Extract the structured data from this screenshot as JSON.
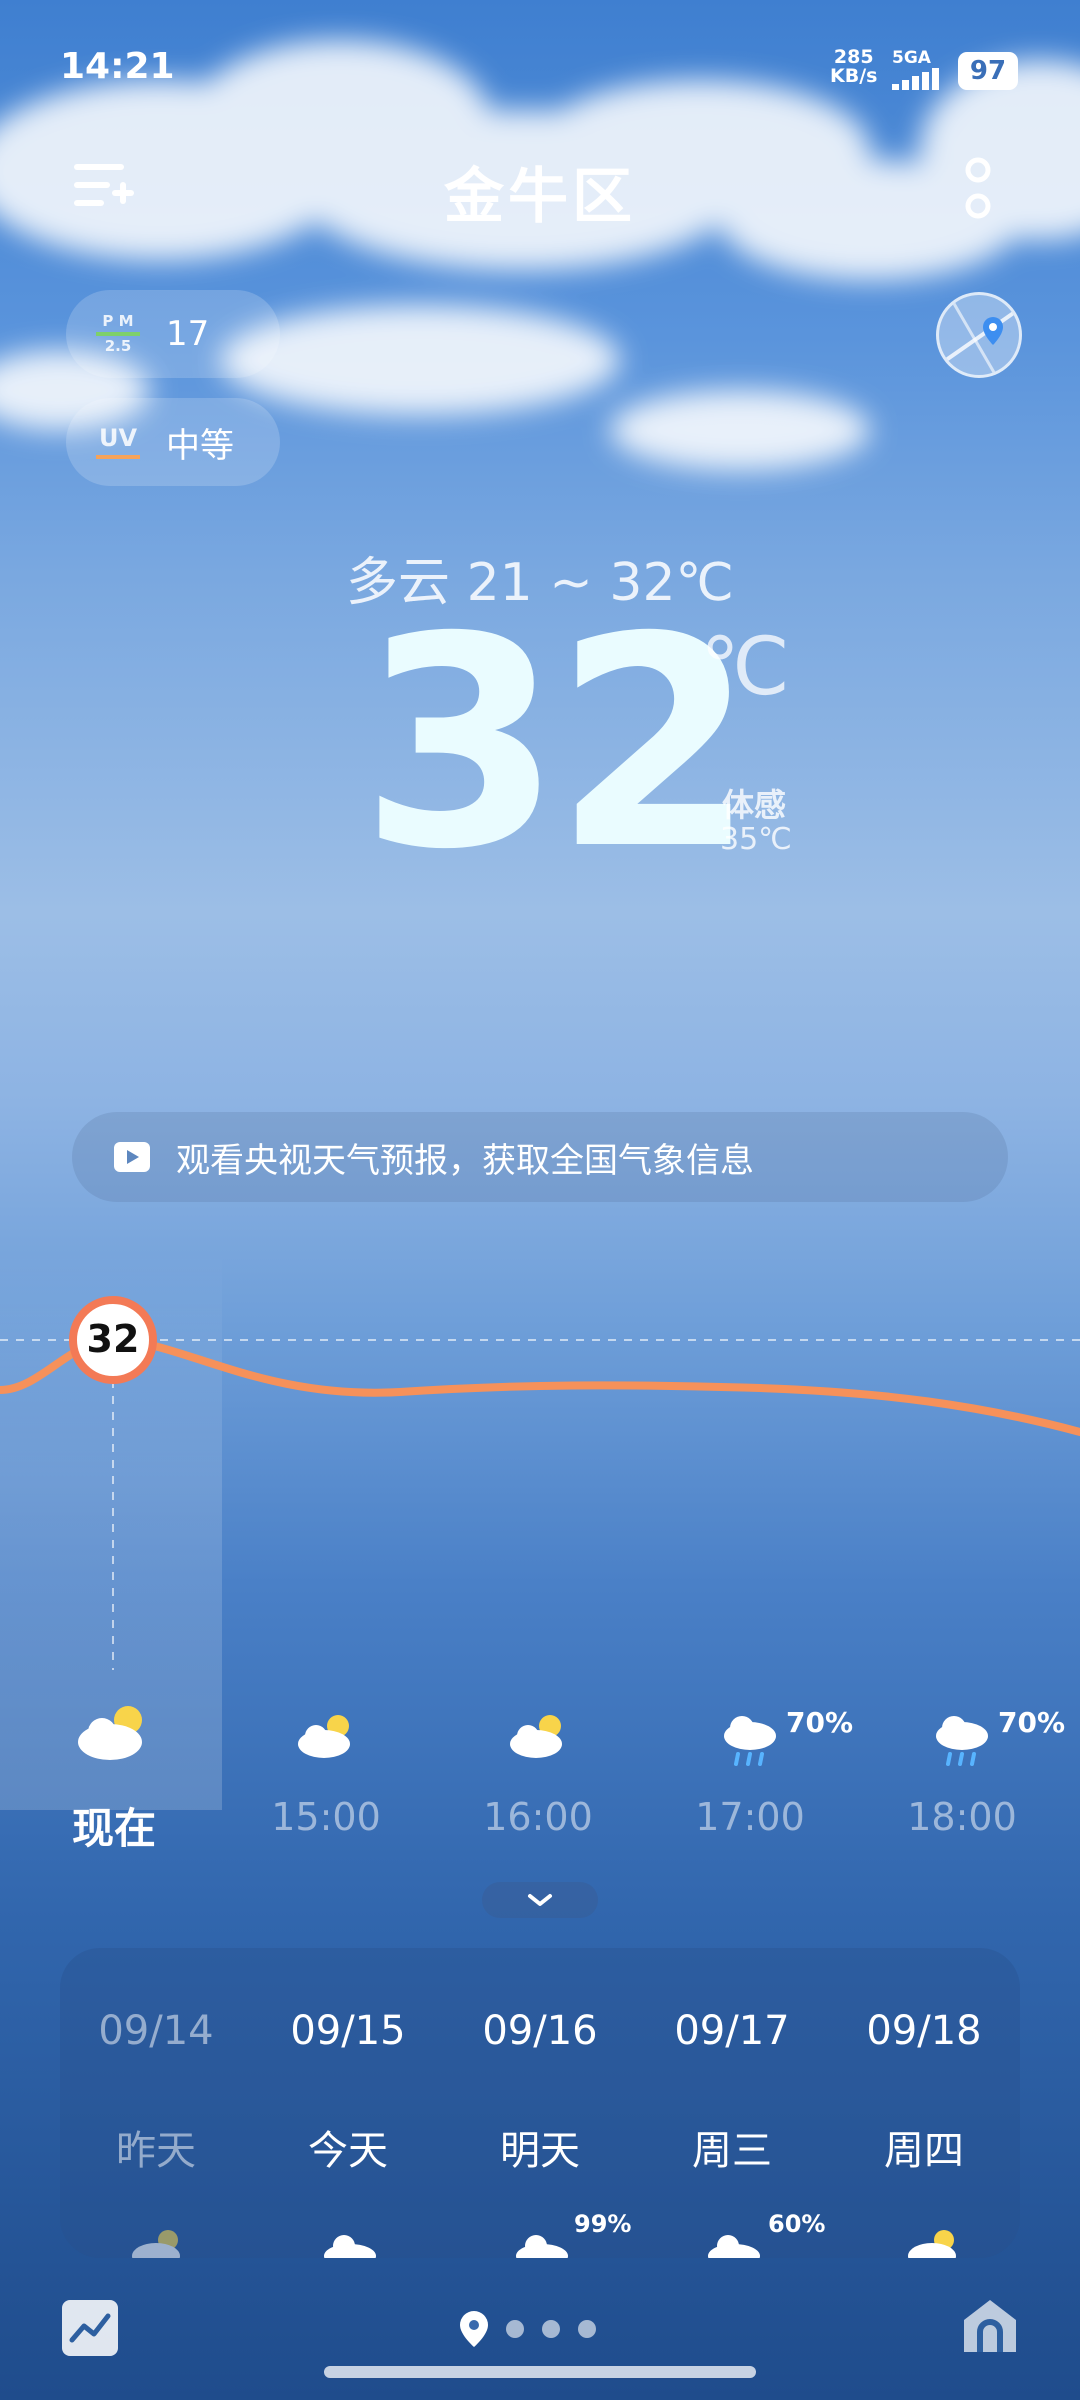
{
  "status_bar": {
    "time": "14:21",
    "net_speed_value": "285",
    "net_speed_unit": "KB/s",
    "network_type": "5GA",
    "battery": "97"
  },
  "header": {
    "city": "金牛区",
    "menu_icon": "list-add-icon",
    "more_icon": "vertical-dots-icon"
  },
  "air": {
    "pm_label_top": "P M",
    "pm_label_bottom": "2.5",
    "pm_value": "17",
    "uv_label": "UV",
    "uv_value": "中等"
  },
  "current": {
    "condition_range": "多云  21 ~ 32℃",
    "temp": "32",
    "unit": "℃",
    "feels_label": "体感",
    "feels_value": "35℃"
  },
  "banner": {
    "text": "观看央视天气预报，获取全国气象信息",
    "icon": "video-play-icon"
  },
  "hourly": {
    "current_marker": "32",
    "items": [
      {
        "time": "现在",
        "icon": "partly-cloudy-icon",
        "precip": ""
      },
      {
        "time": "15:00",
        "icon": "partly-cloudy-icon",
        "precip": ""
      },
      {
        "time": "16:00",
        "icon": "partly-cloudy-icon",
        "precip": ""
      },
      {
        "time": "17:00",
        "icon": "rain-cloud-icon",
        "precip": "70%"
      },
      {
        "time": "18:00",
        "icon": "rain-cloud-icon",
        "precip": "70%"
      }
    ]
  },
  "daily": {
    "items": [
      {
        "date": "09/14",
        "day": "昨天",
        "precip": ""
      },
      {
        "date": "09/15",
        "day": "今天",
        "precip": ""
      },
      {
        "date": "09/16",
        "day": "明天",
        "precip": "99%"
      },
      {
        "date": "09/17",
        "day": "周三",
        "precip": "60%"
      },
      {
        "date": "09/18",
        "day": "周四",
        "precip": ""
      }
    ]
  },
  "colors": {
    "temp_line": "#f6915a",
    "accent_white": "#ffffff",
    "sun_yellow": "#f8d44a"
  }
}
